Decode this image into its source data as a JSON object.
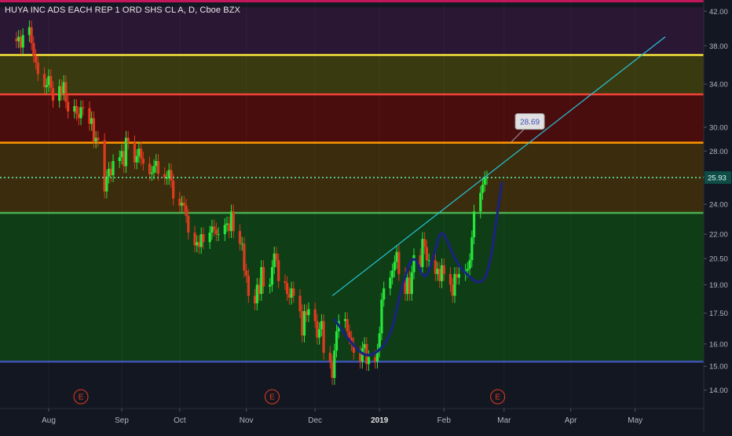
{
  "chart_data": {
    "type": "candlestick",
    "title": "HUYA INC ADS EACH REP 1 ORD SHS CL A, D, Cboe BZX",
    "xlabel": "",
    "ylabel": "",
    "y_scale": "log",
    "ylim": [
      13.7,
      43.0
    ],
    "y_ticks": [
      "42.00",
      "38.00",
      "34.00",
      "30.00",
      "28.00",
      "26.00",
      "24.00",
      "22.00",
      "20.50",
      "19.00",
      "17.50",
      "16.00",
      "15.00",
      "14.00"
    ],
    "x_ticks": [
      "Aug",
      "Sep",
      "Oct",
      "Nov",
      "Dec",
      "2019",
      "Feb",
      "Mar",
      "Apr",
      "May"
    ],
    "x_tick_dates": [
      "2018-08-01",
      "2018-09-04",
      "2018-10-01",
      "2018-11-01",
      "2018-12-03",
      "2019-01-02",
      "2019-02-01",
      "2019-03-01",
      "2019-04-01",
      "2019-05-01"
    ],
    "last_price": "25.93",
    "last_price_color": "#26c6da",
    "annotation": {
      "label": "28.69",
      "value": 28.69
    },
    "earnings_markers": {
      "label": "E",
      "dates": [
        "2018-08-16",
        "2018-11-13",
        "2019-02-26"
      ]
    },
    "horizontal_levels": [
      {
        "value": 37.0,
        "color": "#ffeb3b"
      },
      {
        "value": 33.0,
        "color": "#f44336"
      },
      {
        "value": 28.69,
        "color": "#ff9800"
      },
      {
        "value": 23.4,
        "color": "#4caf50"
      },
      {
        "value": 15.2,
        "color": "#3f51b5"
      }
    ],
    "zones": [
      {
        "from": 42.5,
        "to": 37.0,
        "color": "#2a1733"
      },
      {
        "from": 37.0,
        "to": 33.0,
        "color": "#3a3a10"
      },
      {
        "from": 33.0,
        "to": 28.69,
        "color": "#4a0d0d"
      },
      {
        "from": 28.69,
        "to": 23.4,
        "color": "#3a2c0c"
      },
      {
        "from": 23.4,
        "to": 15.2,
        "color": "#0f3d16"
      }
    ],
    "trendline": {
      "from": {
        "date": "2018-12-11",
        "value": 18.4
      },
      "to": {
        "date": "2019-05-15",
        "value": 39.0
      },
      "color": "#26c6da"
    },
    "pattern_curve": {
      "color": "#1a237e",
      "points": [
        [
          "2018-12-12",
          17.2
        ],
        [
          "2018-12-20",
          16.0
        ],
        [
          "2018-12-28",
          15.3
        ],
        [
          "2019-01-07",
          16.2
        ],
        [
          "2019-01-12",
          18.8
        ],
        [
          "2019-01-18",
          21.0
        ],
        [
          "2019-01-23",
          19.0
        ],
        [
          "2019-01-28",
          21.0
        ],
        [
          "2019-01-31",
          22.5
        ],
        [
          "2019-02-06",
          20.4
        ],
        [
          "2019-02-12",
          19.5
        ],
        [
          "2019-02-18",
          19.0
        ],
        [
          "2019-02-22",
          19.8
        ],
        [
          "2019-02-25",
          22.5
        ],
        [
          "2019-02-28",
          25.6
        ]
      ]
    },
    "series": [
      {
        "type": "candlestick",
        "start_date": "2018-07-17",
        "close": [
          38.5,
          39.0,
          37.8,
          39.2,
          40.1,
          38.3,
          36.9,
          36.2,
          35.0,
          33.7,
          33.9,
          34.8,
          33.6,
          32.4,
          33.8,
          33.1,
          34.2,
          32.3,
          31.4,
          31.9,
          31.2,
          30.8,
          31.8,
          31.7,
          30.3,
          30.8,
          28.8,
          29.1,
          28.9,
          24.9,
          26.0,
          26.6,
          26.1,
          27.2,
          27.5,
          28.0,
          26.8,
          29.1,
          28.7,
          27.1,
          27.6,
          28.2,
          27.4,
          27.0,
          26.2,
          26.3,
          26.8,
          27.2,
          26.2,
          25.9,
          25.9,
          26.5,
          25.7,
          24.4,
          23.9,
          24.1,
          23.9,
          23.2,
          22.1,
          21.3,
          21.5,
          21.2,
          22.0,
          21.5,
          22.1,
          22.5,
          22.3,
          22.0,
          22.0,
          22.6,
          22.7,
          22.2,
          23.5,
          22.2,
          21.4,
          21.4,
          19.8,
          19.5,
          18.4,
          18.0,
          19.0,
          18.5,
          20.0,
          18.9,
          19.0,
          20.0,
          20.8,
          20.4,
          19.2,
          19.1,
          18.5,
          18.3,
          18.8,
          18.4,
          17.6,
          16.4,
          17.6,
          17.4,
          17.7,
          17.1,
          16.3,
          16.7,
          17.1,
          15.6,
          15.2,
          14.5,
          15.7,
          16.6,
          17.1,
          17.2,
          16.6,
          16.3,
          16.0,
          15.6,
          15.2,
          15.8,
          16.0,
          15.1,
          15.4,
          15.2,
          15.7,
          16.5,
          18.2,
          18.8,
          19.4,
          19.8,
          20.3,
          20.9,
          19.6,
          18.5,
          19.4,
          18.5,
          19.7,
          20.7,
          20.0,
          21.7,
          21.2,
          20.4,
          20.4,
          19.6,
          19.9,
          19.2,
          20.1,
          19.6,
          19.0,
          18.4,
          19.6,
          19.4,
          19.6,
          19.8,
          19.9,
          20.4,
          21.8,
          23.5,
          24.8,
          25.4,
          25.9,
          25.93
        ],
        "open": [
          38.8,
          38.5,
          39.0,
          37.8,
          39.2,
          40.1,
          38.3,
          36.9,
          36.2,
          35.0,
          33.7,
          33.9,
          34.8,
          33.6,
          32.4,
          33.8,
          33.1,
          34.2,
          32.3,
          31.4,
          31.9,
          31.2,
          30.8,
          31.8,
          31.7,
          30.3,
          30.8,
          28.8,
          29.1,
          28.9,
          24.9,
          26.0,
          26.6,
          26.1,
          27.2,
          27.5,
          28.0,
          26.8,
          29.1,
          28.7,
          27.1,
          27.6,
          28.2,
          27.4,
          27.0,
          26.2,
          26.3,
          26.8,
          27.2,
          26.2,
          25.9,
          25.9,
          26.5,
          25.7,
          24.4,
          23.9,
          24.1,
          23.9,
          23.2,
          22.1,
          21.3,
          21.5,
          21.2,
          22.0,
          21.5,
          22.1,
          22.5,
          22.3,
          22.0,
          22.0,
          22.6,
          22.7,
          22.2,
          23.5,
          22.2,
          21.4,
          21.4,
          19.8,
          19.5,
          18.4,
          18.0,
          19.0,
          18.5,
          20.0,
          18.9,
          19.0,
          20.0,
          20.8,
          20.4,
          19.2,
          19.1,
          18.5,
          18.3,
          18.8,
          18.4,
          17.6,
          16.4,
          17.6,
          17.4,
          17.7,
          17.1,
          16.3,
          16.7,
          17.1,
          15.6,
          15.2,
          14.5,
          15.7,
          16.6,
          17.1,
          17.2,
          16.6,
          16.3,
          16.0,
          15.6,
          15.2,
          15.8,
          16.0,
          15.1,
          15.4,
          15.2,
          15.7,
          16.5,
          18.2,
          18.8,
          19.4,
          19.8,
          20.3,
          20.9,
          19.6,
          18.5,
          19.4,
          18.5,
          19.7,
          20.7,
          20.0,
          21.7,
          21.2,
          20.4,
          20.4,
          19.6,
          19.9,
          19.2,
          20.1,
          19.6,
          19.0,
          18.4,
          19.6,
          19.4,
          19.6,
          19.8,
          19.9,
          20.4,
          21.8,
          23.5,
          24.8,
          25.4,
          25.9
        ]
      }
    ]
  }
}
